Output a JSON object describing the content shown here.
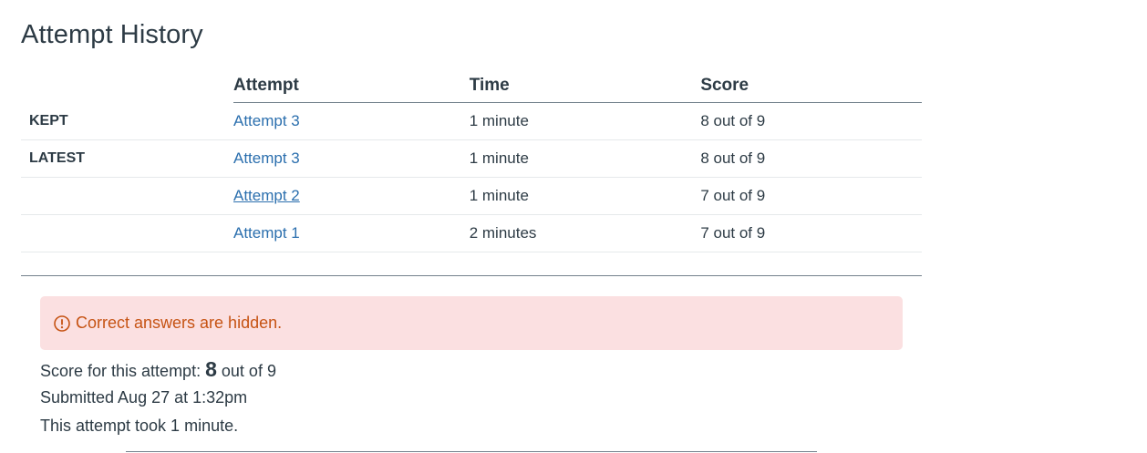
{
  "page": {
    "title": "Attempt History"
  },
  "history_table": {
    "columns": [
      "Attempt",
      "Time",
      "Score"
    ],
    "rows": [
      {
        "label": "KEPT",
        "attempt": "Attempt 3",
        "time": "1 minute",
        "score": "8 out of 9"
      },
      {
        "label": "LATEST",
        "attempt": "Attempt 3",
        "time": "1 minute",
        "score": "8 out of 9"
      },
      {
        "label": "",
        "attempt": "Attempt 2",
        "time": "1 minute",
        "score": "7 out of 9"
      },
      {
        "label": "",
        "attempt": "Attempt 1",
        "time": "2 minutes",
        "score": "7 out of 9"
      }
    ]
  },
  "alert": {
    "icon": "warning-circle-icon",
    "text": "Correct answers are hidden.",
    "color": "#c65313",
    "background": "#fbe0e1"
  },
  "summary": {
    "score_prefix": "Score for this attempt:",
    "score_value": "8",
    "score_suffix": "out of 9",
    "submitted": "Submitted Aug 27 at 1:32pm",
    "duration": "This attempt took 1 minute."
  },
  "colors": {
    "link": "#2b6fae",
    "text": "#2d3b45"
  }
}
